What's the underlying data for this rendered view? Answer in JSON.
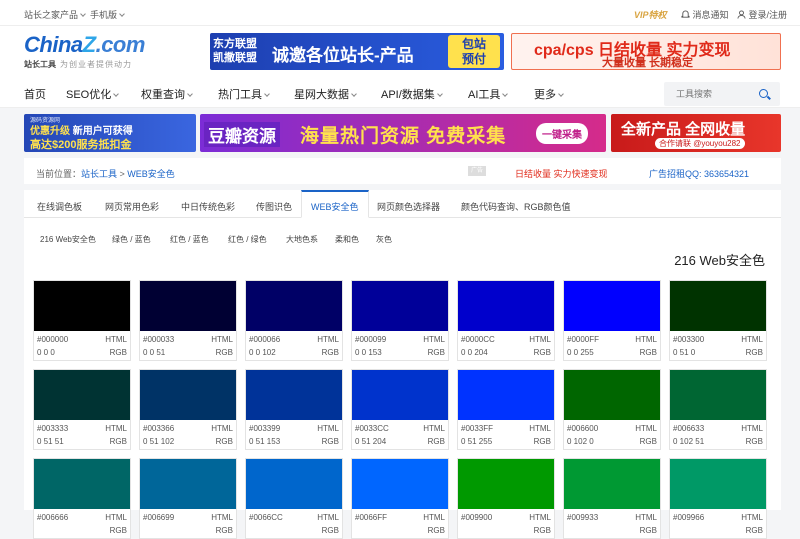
{
  "topbar": {
    "site_products": "站长之家产品",
    "mobile": "手机版",
    "vip": "VIP特权",
    "messages": "消息通知",
    "login": "登录/注册"
  },
  "logo": {
    "brand_a": "China",
    "brand_z": "Z",
    "brand_com": ".com",
    "sub": "站长工具",
    "tagline": "为创业者提供动力"
  },
  "header_ads": {
    "ad1_left_line1": "东方联盟",
    "ad1_left_line2": "凯撒联盟",
    "ad1_main": "诚邀各位站长-产品",
    "ad1_badge_line1": "包站",
    "ad1_badge_line2": "预付",
    "ad2_main": "cpa/cps 日结收量 实力变现",
    "ad2_sub": "大量收量 长期稳定"
  },
  "nav": {
    "items": [
      "首页",
      "SEO优化",
      "权重查询",
      "热门工具",
      "星网大数据",
      "API/数据集",
      "AI工具",
      "更多"
    ],
    "search_placeholder": "工具搜索"
  },
  "banners": {
    "b1_small": "源码资源网",
    "b1_line1_a": "优惠升级",
    "b1_line1_b": "新用户可获得",
    "b1_line2": "高达$200服务抵扣金",
    "b2_left": "豆瓣资源",
    "b2_main": "海量热门资源 免费采集",
    "b2_button": "一键采集",
    "b3_main": "全新产品 全网收量",
    "b3_contact": "合作请联 @youyou282"
  },
  "breadcrumb": {
    "prefix": "当前位置：",
    "link1": "站长工具",
    "sep": " > ",
    "current": "WEB安全色",
    "ad_tag": "广告",
    "red_text": "日结收量 实力快速变现",
    "qq": "广告招租QQ:  363654321"
  },
  "tabs": [
    "在线调色板",
    "网页常用色彩",
    "中日传统色彩",
    "传图识色",
    "WEB安全色",
    "网页颜色选择器",
    "颜色代码查询、RGB颜色值"
  ],
  "subtabs": [
    "216 Web安全色",
    "绿色 / 蓝色",
    "红色 / 蓝色",
    "红色 / 绿色",
    "大地色系",
    "柔和色",
    "灰色"
  ],
  "page_title": "216 Web安全色",
  "label_html": "HTML",
  "label_rgb": "RGB",
  "colors": [
    {
      "hex": "#000000",
      "rgb": "0 0 0"
    },
    {
      "hex": "#000033",
      "rgb": "0 0 51"
    },
    {
      "hex": "#000066",
      "rgb": "0 0 102"
    },
    {
      "hex": "#000099",
      "rgb": "0 0 153"
    },
    {
      "hex": "#0000CC",
      "rgb": "0 0 204"
    },
    {
      "hex": "#0000FF",
      "rgb": "0 0 255"
    },
    {
      "hex": "#003300",
      "rgb": "0 51 0"
    },
    {
      "hex": "#003333",
      "rgb": "0 51 51"
    },
    {
      "hex": "#003366",
      "rgb": "0 51 102"
    },
    {
      "hex": "#003399",
      "rgb": "0 51 153"
    },
    {
      "hex": "#0033CC",
      "rgb": "0 51 204"
    },
    {
      "hex": "#0033FF",
      "rgb": "0 51 255"
    },
    {
      "hex": "#006600",
      "rgb": "0 102 0"
    },
    {
      "hex": "#006633",
      "rgb": "0 102 51"
    },
    {
      "hex": "#006666",
      "rgb": ""
    },
    {
      "hex": "#006699",
      "rgb": ""
    },
    {
      "hex": "#0066CC",
      "rgb": ""
    },
    {
      "hex": "#0066FF",
      "rgb": ""
    },
    {
      "hex": "#009900",
      "rgb": ""
    },
    {
      "hex": "#009933",
      "rgb": ""
    },
    {
      "hex": "#009966",
      "rgb": ""
    }
  ],
  "accent_color": "#1a63c7"
}
